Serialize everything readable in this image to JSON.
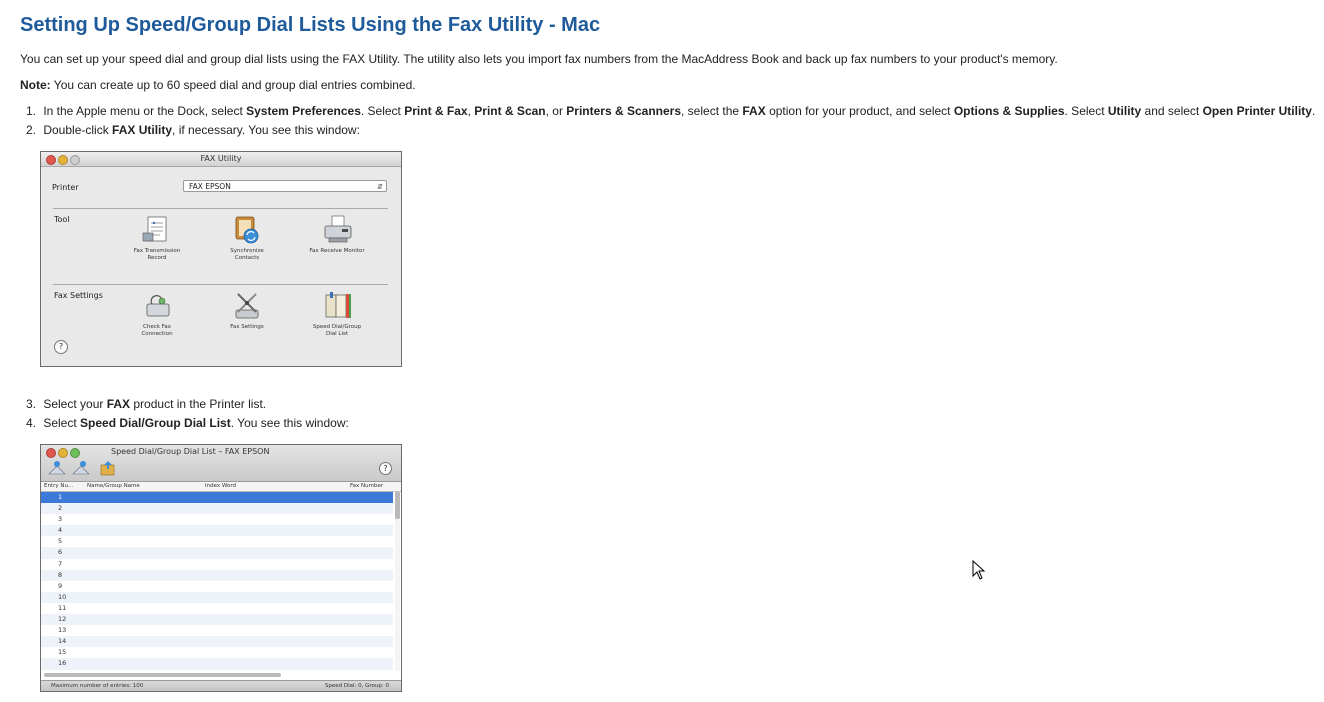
{
  "page": {
    "title": "Setting Up Speed/Group Dial Lists Using the Fax Utility - Mac",
    "intro": "You can set up your speed dial and group dial lists using the FAX Utility. The utility also lets you import fax numbers from the MacAddress Book and back up fax numbers to your product's memory.",
    "note_label": "Note:",
    "note_text": " You can create up to 60 speed dial and group dial entries combined."
  },
  "steps": {
    "s1": {
      "num": "1.",
      "t1": " In the Apple menu or the Dock, select ",
      "b1": "System Preferences",
      "t2": ". Select ",
      "b2": "Print & Fax",
      "t3": ", ",
      "b3": "Print & Scan",
      "t4": ", or ",
      "b4": "Printers & Scanners",
      "t5": ", select the ",
      "b5": "FAX",
      "t6": " option for your product, and select ",
      "b6": "Options & Supplies",
      "t7": ". Select ",
      "b7": "Utility",
      "t8": " and select ",
      "b8": "Open Printer Utility",
      "t9": "."
    },
    "s2": {
      "num": "2.",
      "t1": " Double-click ",
      "b1": "FAX Utility",
      "t2": ", if necessary. You see this window:"
    },
    "s3": {
      "num": "3.",
      "t1": " Select your ",
      "b1": "FAX",
      "t2": " product in the Printer list."
    },
    "s4": {
      "num": "4.",
      "t1": " Select ",
      "b1": "Speed Dial/Group Dial List",
      "t2": ". You see this window:"
    }
  },
  "fax_utility": {
    "title": "FAX Utility",
    "printer_label": "Printer",
    "printer_value": "FAX EPSON",
    "tool_label": "Tool",
    "fax_settings_label": "Fax Settings",
    "tools": [
      {
        "line1": "Fax Transmission",
        "line2": "Record",
        "icon": "fax-record-icon"
      },
      {
        "line1": "Synchronize",
        "line2": "Contacts",
        "icon": "sync-contacts-icon"
      },
      {
        "line1": "Fax Receive Monitor",
        "line2": "",
        "icon": "fax-monitor-icon"
      }
    ],
    "settings": [
      {
        "line1": "Check Fax",
        "line2": "Connection",
        "icon": "check-connection-icon"
      },
      {
        "line1": "Fax Settings",
        "line2": "",
        "icon": "fax-settings-icon"
      },
      {
        "line1": "Speed Dial/Group",
        "line2": "Dial List",
        "icon": "speed-dial-icon"
      }
    ],
    "help": "?"
  },
  "speed_dial": {
    "title": "Speed Dial/Group Dial List – FAX EPSON",
    "help": "?",
    "columns": [
      "Entry Nu...",
      "Name/Group Name",
      "Index Word",
      "Fax Number"
    ],
    "rows": [
      "1",
      "2",
      "3",
      "4",
      "5",
      "6",
      "7",
      "8",
      "9",
      "10",
      "11",
      "12",
      "13",
      "14",
      "15",
      "16"
    ],
    "status_left": "Maximum number of entries: 100",
    "status_right": "Speed Dial: 0, Group: 0"
  }
}
